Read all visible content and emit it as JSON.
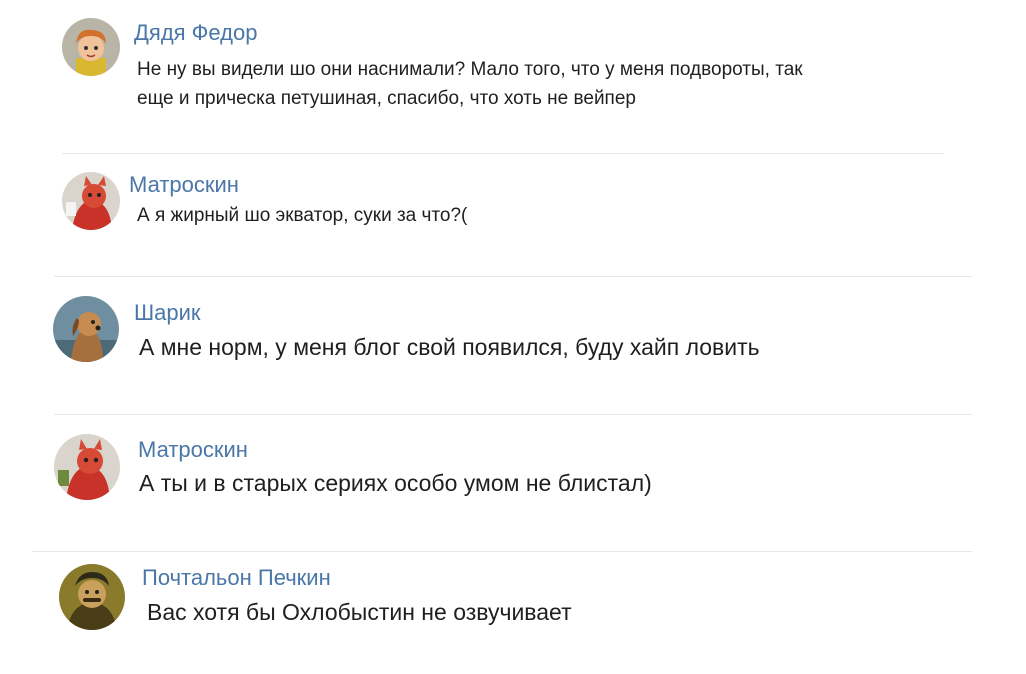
{
  "comments": [
    {
      "author": "Дядя Федор",
      "lines": [
        "Не ну вы видели шо они наснимали? Мало того, что у меня подвороты, так",
        "еще и прическа петушиная, спасибо, что хоть не вейпер"
      ],
      "avatar_icon": "boy-avatar-icon"
    },
    {
      "author": "Матроскин",
      "lines": [
        "А я жирный шо экватор, суки за что?("
      ],
      "avatar_icon": "cat-avatar-icon"
    },
    {
      "author": "Шарик",
      "lines": [
        "А мне норм, у меня блог свой появился, буду хайп ловить"
      ],
      "avatar_icon": "dog-avatar-icon"
    },
    {
      "author": "Матроскин",
      "lines": [
        "А ты и в старых сериях особо умом не блистал)"
      ],
      "avatar_icon": "cat-avatar-icon"
    },
    {
      "author": "Почтальон Печкин",
      "lines": [
        "Вас хотя бы Охлобыстин не озвучивает"
      ],
      "avatar_icon": "postman-avatar-icon"
    }
  ],
  "colors": {
    "author_name": "#4a76a8",
    "text": "#1f1f1f",
    "divider": "#e3e6ea"
  }
}
